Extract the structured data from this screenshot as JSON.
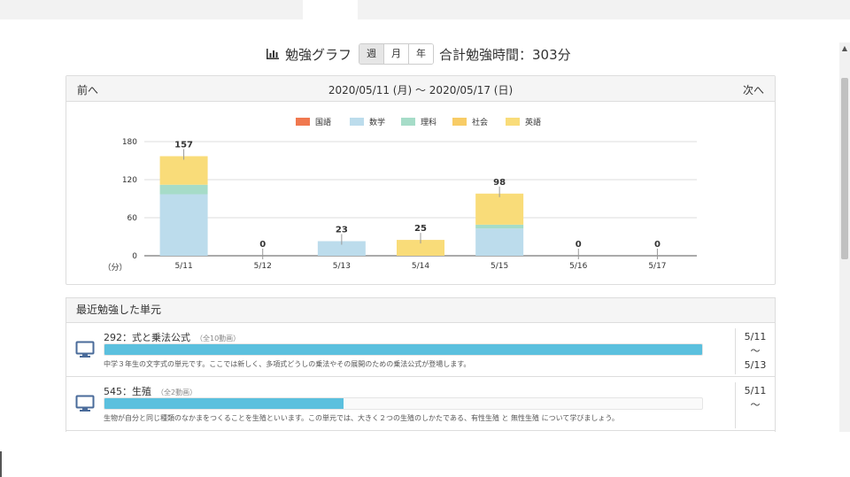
{
  "header": {
    "title": "勉強グラフ",
    "periods": [
      {
        "label": "週",
        "active": true
      },
      {
        "label": "月",
        "active": false
      },
      {
        "label": "年",
        "active": false
      }
    ],
    "total": "合計勉強時間：303分"
  },
  "chart_panel": {
    "prev": "前へ",
    "next": "次へ",
    "range": "2020/05/11 (月) 〜 2020/05/17 (日)"
  },
  "chart_data": {
    "type": "bar",
    "stacked": true,
    "categories": [
      "5/11",
      "5/12",
      "5/13",
      "5/14",
      "5/15",
      "5/16",
      "5/17"
    ],
    "series": [
      {
        "name": "国語",
        "color": "#f0784f",
        "values": [
          0,
          0,
          0,
          0,
          0,
          0,
          0
        ]
      },
      {
        "name": "数学",
        "color": "#bcdcec",
        "values": [
          97,
          0,
          23,
          0,
          43,
          0,
          0
        ]
      },
      {
        "name": "理科",
        "color": "#a6dcc8",
        "values": [
          15,
          0,
          0,
          0,
          6,
          0,
          0
        ]
      },
      {
        "name": "社会",
        "color": "#f8cc66",
        "values": [
          0,
          0,
          0,
          0,
          0,
          0,
          0
        ]
      },
      {
        "name": "英語",
        "color": "#f9dc79",
        "values": [
          45,
          0,
          0,
          25,
          49,
          0,
          0
        ]
      }
    ],
    "totals": [
      "157",
      "0",
      "23",
      "25",
      "98",
      "0",
      "0"
    ],
    "yticks": [
      "180",
      "120",
      "60",
      "0"
    ],
    "ylim": [
      0,
      180
    ],
    "ylabel": "（分）",
    "grid": true,
    "legend": "top"
  },
  "recent": {
    "title": "最近勉強した単元",
    "items": [
      {
        "title": "292：式と乗法公式",
        "count": "（全10動画）",
        "progress": 1.0,
        "desc": "中学３年生の文字式の単元です。ここでは新しく、多項式どうしの乗法やその展開のための乗法公式が登場します。",
        "date_start": "5/11",
        "tilde": "〜",
        "date_end": "5/13"
      },
      {
        "title": "545：生殖",
        "count": "（全2動画）",
        "progress": 0.4,
        "desc": "生物が自分と同じ種類のなかまをつくることを生殖といいます。この単元では、大きく２つの生殖のしかたである、有性生殖 と 無性生殖 について学びましょう。",
        "date_start": "5/11",
        "tilde": "〜",
        "date_end": ""
      }
    ]
  }
}
